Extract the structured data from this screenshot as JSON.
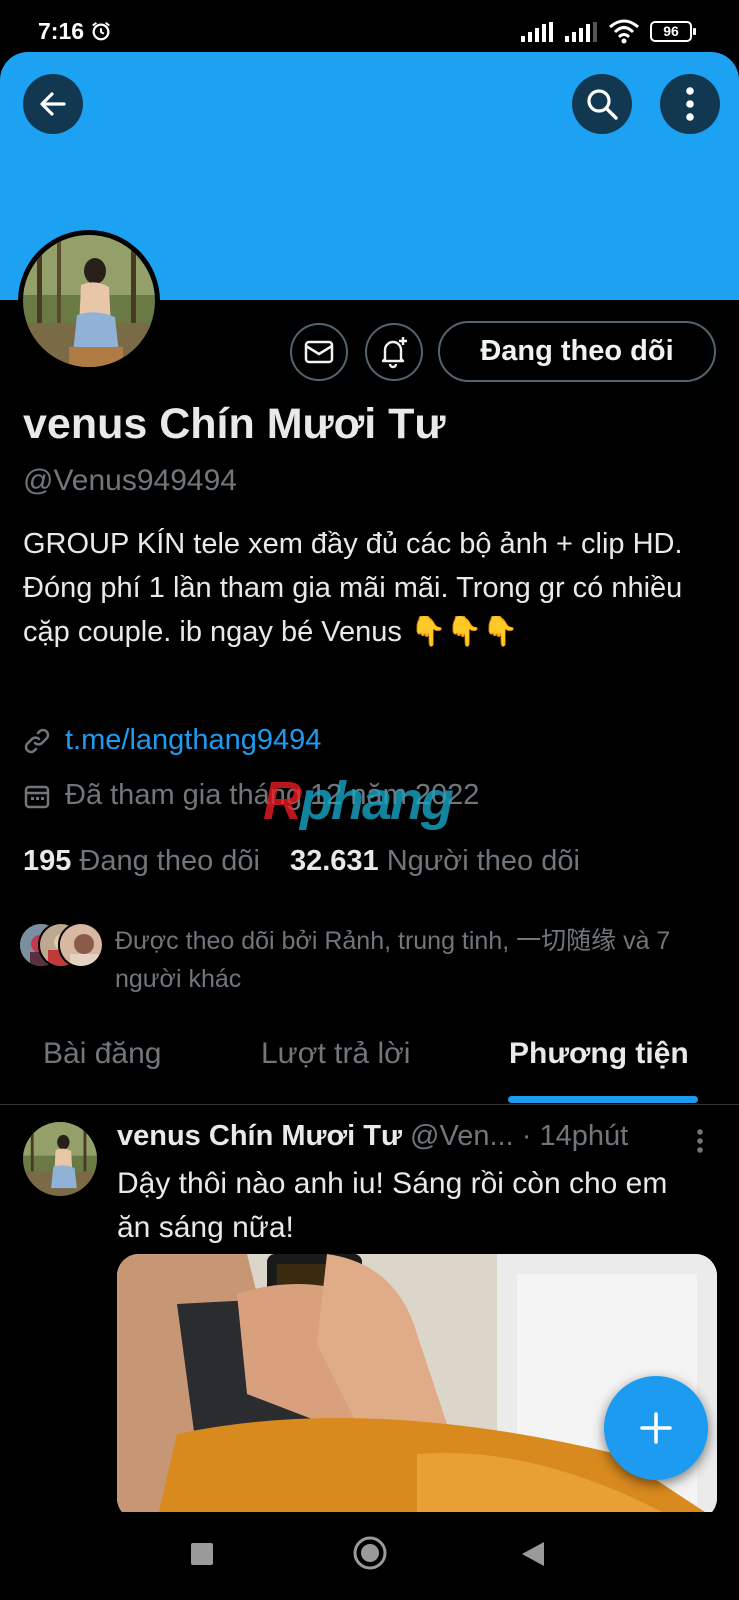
{
  "status_bar": {
    "time": "7:16",
    "battery": "96"
  },
  "profile": {
    "display_name": "venus Chín Mươi Tư",
    "handle": "@Venus949494",
    "bio": "GROUP KÍN  tele xem đầy đủ các bộ ảnh + clip HD. Đóng phí 1 lần tham gia mãi mãi. Trong gr có nhiều cặp couple. ib ngay bé Venus 👇👇👇",
    "link": "t.me/langthang9494",
    "joined": "Đã tham gia tháng 12 năm 2022",
    "following_button": "Đang theo dõi",
    "following_count": "195",
    "following_label": "Đang theo dõi",
    "followers_count": "32.631",
    "followers_label": "Người theo dõi",
    "followed_by": "Được theo dõi bởi Rảnh, trung tinh, 一切随缘 và 7 người khác"
  },
  "watermark": {
    "first": "R",
    "rest": "phang"
  },
  "tabs": [
    {
      "label": "Bài đăng",
      "active": false
    },
    {
      "label": "Lượt trả lời",
      "active": false
    },
    {
      "label": "Phương tiện",
      "active": true
    }
  ],
  "post": {
    "name": "venus Chín Mươi Tư",
    "handle": "@Ven...",
    "separator": "·",
    "time": "14phút",
    "text": "Dậy thôi nào anh iu! Sáng rồi còn cho em ăn sáng nữa!"
  },
  "colors": {
    "banner": "#1da1f2",
    "accent": "#1d9bf0",
    "secondary_text": "#71767b"
  },
  "icons": {
    "back": "arrow-left-icon",
    "search": "search-icon",
    "more": "more-vertical-icon",
    "message": "mail-icon",
    "notify": "bell-plus-icon",
    "link": "link-icon",
    "calendar": "calendar-icon",
    "fab": "plus-icon"
  }
}
